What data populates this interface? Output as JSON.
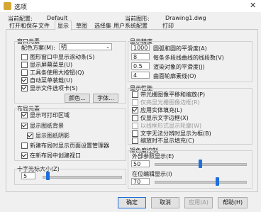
{
  "window": {
    "title": "选项"
  },
  "header": {
    "current_profile_label": "当前配置:",
    "current_profile_value": "Default",
    "current_drawing_label": "当前图形:",
    "current_drawing_value": "Drawing1.dwg"
  },
  "tabs": [
    {
      "label": "打开和保存"
    },
    {
      "label": "文件"
    },
    {
      "label": "显示"
    },
    {
      "label": "草图"
    },
    {
      "label": "选择集"
    },
    {
      "label": "用户系统配置"
    },
    {
      "label": "打印"
    }
  ],
  "window_elements": {
    "heading": "窗口元素",
    "color_scheme_label": "配色方案(M):",
    "color_scheme_value": "明",
    "checkboxes": [
      {
        "label": "图形窗口中显示滚动条(S)",
        "checked": false
      },
      {
        "label": "显示屏幕菜单(U)",
        "checked": false
      },
      {
        "label": "工具条使用大按钮(Q)",
        "checked": false
      },
      {
        "label": "自动菜单装载(U)",
        "checked": true
      },
      {
        "label": "显示文件选项卡(S)",
        "checked": true
      }
    ],
    "colors_button": "颜色...",
    "fonts_button": "字体..."
  },
  "layout_elements": {
    "heading": "布局元素",
    "checkboxes": [
      {
        "label": "显示可打印区域",
        "checked": true
      },
      {
        "label": "显示图纸背景",
        "checked": true
      },
      {
        "label": "显示图纸阴影",
        "checked": true
      },
      {
        "label": "新建布局时显示页面设置管理器",
        "checked": false
      },
      {
        "label": "在新布局中创建视口",
        "checked": true
      }
    ]
  },
  "crosshair": {
    "label": "十字光标大小(Z)",
    "value": "5",
    "slider_fraction": 0.05
  },
  "display_resolution": {
    "heading": "显示精度",
    "items": [
      {
        "value": "1000",
        "label": "圆弧和圆的平滑度(A)"
      },
      {
        "value": "8",
        "label": "每条多段线曲线的线段数(V)"
      },
      {
        "value": "0.5",
        "label": "渲染对象的平滑度(J)"
      },
      {
        "value": "4",
        "label": "曲面轮廓素线(O)"
      }
    ]
  },
  "display_performance": {
    "heading": "显示性能",
    "checkboxes": [
      {
        "label": "带光栅图像平移和缩放(P)",
        "checked": false,
        "disabled": false
      },
      {
        "label": "仅亮显光栅图像边框(R)",
        "checked": false,
        "disabled": true
      },
      {
        "label": "应用实体填充(L)",
        "checked": true,
        "disabled": false
      },
      {
        "label": "仅显示文字边框(X)",
        "checked": false,
        "disabled": false
      },
      {
        "label": "以线框形式显示轮廓(W)",
        "checked": false,
        "disabled": true
      },
      {
        "label": "文字无法分辨时显示为框(B)",
        "checked": false,
        "disabled": false
      },
      {
        "label": "缩放时不显示填充(C)",
        "checked": false,
        "disabled": false
      }
    ]
  },
  "fade_control": {
    "heading": "褪色度控制",
    "xref_label": "外部参照显示(E)",
    "xref_value": "50",
    "xref_fraction": 0.5,
    "inplace_label": "在位编辑显示(I)",
    "inplace_value": "70",
    "inplace_fraction": 0.7
  },
  "buttons": {
    "ok": "确定",
    "cancel": "取消",
    "apply": "应用(A)",
    "help": "帮助(H)"
  }
}
